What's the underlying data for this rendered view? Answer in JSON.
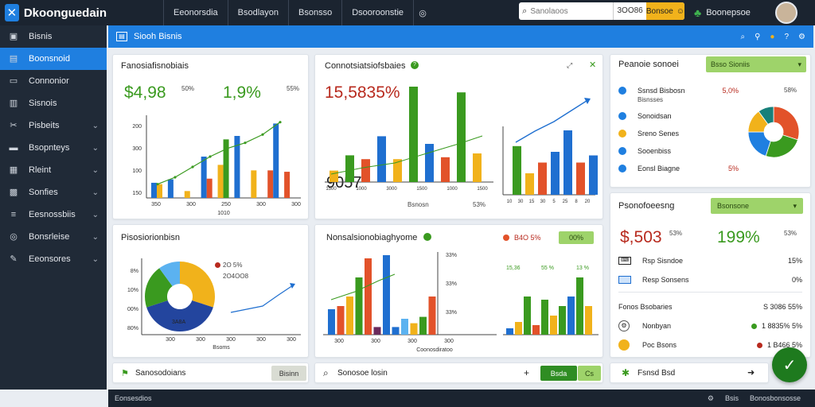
{
  "app": {
    "title": "Dkoonguedain"
  },
  "top_tabs": [
    "Eeonorsdia",
    "Bsodlayon",
    "Bsonsso",
    "Dsooroonstie"
  ],
  "search": {
    "placeholder": "Sanolaoos",
    "value": "3OO86",
    "button": "Bonsoe"
  },
  "user": {
    "name": "Boonepsoe"
  },
  "sidebar": {
    "items": [
      {
        "label": "Bisnis",
        "icon": "dashboard-icon",
        "active": false,
        "chevron": false
      },
      {
        "label": "Boonsnoid",
        "icon": "chart-icon",
        "active": true,
        "chevron": false
      },
      {
        "label": "Connonior",
        "icon": "folder-icon",
        "active": false,
        "chevron": false
      },
      {
        "label": "Sisnois",
        "icon": "grid-icon",
        "active": false,
        "chevron": false
      },
      {
        "label": "Pisbeits",
        "icon": "tools-icon",
        "active": false,
        "chevron": true
      },
      {
        "label": "Bsopnteys",
        "icon": "briefcase-icon",
        "active": false,
        "chevron": true
      },
      {
        "label": "Rleint",
        "icon": "calendar-icon",
        "active": false,
        "chevron": true
      },
      {
        "label": "Sonfies",
        "icon": "cart-icon",
        "active": false,
        "chevron": true
      },
      {
        "label": "Eesnossbiis",
        "icon": "list-icon",
        "active": false,
        "chevron": true
      },
      {
        "label": "Bonsrleise",
        "icon": "settings-icon",
        "active": false,
        "chevron": true
      },
      {
        "label": "Eeonsores",
        "icon": "pen-icon",
        "active": false,
        "chevron": true
      }
    ]
  },
  "header": {
    "title": "Siooh Bisnis"
  },
  "card1": {
    "title": "Fanosiafisnobiais",
    "value_a": "$4,98",
    "tag_a": "50%",
    "value_b": "1,9%",
    "tag_b": "55%",
    "y_ticks": [
      "200",
      "300",
      "100",
      "150"
    ],
    "x_ticks": [
      "350",
      "300",
      "250",
      "300",
      "300"
    ],
    "x_sub": "1010"
  },
  "card2": {
    "title": "Connotsiatsiofsbaies",
    "value_a": "15,5835%",
    "value_b": "9057",
    "foot_a": "Bsnosn",
    "foot_b": "53%",
    "left_ticks": [
      "1500",
      "1000",
      "3000",
      "1500",
      "1000",
      "1500"
    ],
    "right_ticks": [
      "10",
      "30",
      "15",
      "30",
      "5",
      "25",
      "8",
      "20"
    ]
  },
  "card3": {
    "title": "Pisosiorionbisn",
    "legend_value": "2O 5%",
    "legend_sub": "2O4OO8",
    "pie_label": "3A8A",
    "y_ticks": [
      "8%",
      "10%",
      "00%",
      "80%"
    ],
    "x_ticks": [
      "300",
      "300",
      "300",
      "300",
      "300"
    ],
    "x_sub": "Bsoms"
  },
  "card4": {
    "title": "Nonsalsionobiaghyome",
    "status_value": "B4O 5%",
    "pill": "00%",
    "col_ticks": [
      "33%",
      "33%",
      "33%"
    ],
    "right_labels": [
      "15,36",
      "55 %",
      "13 %"
    ],
    "x_ticks": [
      "300",
      "300",
      "300",
      "300"
    ],
    "x_sub": "Coonosdiratoo"
  },
  "right1": {
    "title": "Peanoie sonoei",
    "button": "Bsso Sioniis",
    "rows": [
      {
        "label": "Ssnsd Bisbosn",
        "value": "5,0%",
        "color": "#1f7fe0"
      },
      {
        "label": "Sonoidsan",
        "value": "",
        "color": "#1f7fe0"
      },
      {
        "label": "Sreno Senes",
        "value": "",
        "color": "#f1b21b"
      },
      {
        "label": "Sooenbiss",
        "value": "",
        "color": "#1f7fe0"
      },
      {
        "label": "Eonsl Biagne",
        "value": "5%",
        "color": "#1f7fe0"
      }
    ],
    "row_tag": "58%",
    "sub_row": "Bisnsses"
  },
  "right2": {
    "title": "Psonofoeesng",
    "button": "Bsonsone",
    "value_a": "$,503",
    "tag_a": "53%",
    "value_b": "199%",
    "tag_b": "53%",
    "rows": [
      {
        "label": "Rsp Sisndoe",
        "value": "15%"
      },
      {
        "label": "Resp Sonsens",
        "value": "0%"
      }
    ],
    "section": "Fonos Bsobaries",
    "section_value": "S 3086 55%",
    "items": [
      {
        "label": "Nonbyan",
        "value": "1 8835% 5%",
        "color": "#3a9a1f"
      },
      {
        "label": "Poc Bsons",
        "value": "1 B466 5%",
        "color": "#b82a1e"
      }
    ]
  },
  "bottom_bar": {
    "left_label": "Sanosodoians",
    "left_button": "Bisinn",
    "search_label": "Sonosoe losin",
    "plus": "+",
    "green_button": "Bsda",
    "second_button": "Cs",
    "right_label": "Fsnsd Bsd"
  },
  "footer": {
    "left": "Eonsesdios",
    "right_a": "Bsis",
    "right_b": "Bonosbonsosse"
  },
  "chart_data": [
    {
      "type": "bar",
      "title": "Fanosiafisnobiais",
      "categories": [
        "1",
        "2",
        "3",
        "4",
        "5",
        "6",
        "7",
        "8",
        "9"
      ],
      "series": [
        {
          "values": [
            22,
            27,
            0,
            60,
            0,
            0,
            0,
            0,
            0
          ],
          "color": "#1f6fd0"
        },
        {
          "values": [
            20,
            0,
            10,
            0,
            48,
            0,
            40,
            0,
            0
          ],
          "color": "#f1b21b"
        },
        {
          "values": [
            0,
            0,
            0,
            28,
            0,
            0,
            0,
            40,
            38
          ],
          "color": "#e2522a"
        },
        {
          "values": [
            0,
            0,
            0,
            0,
            85,
            0,
            0,
            0,
            0
          ],
          "color": "#3a9a1f"
        },
        {
          "values": [
            0,
            0,
            0,
            0,
            0,
            90,
            0,
            108,
            0
          ],
          "color": "#1f6fd0"
        }
      ],
      "trend": [
        20,
        30,
        45,
        60,
        72,
        80,
        92,
        110
      ]
    },
    {
      "type": "bar",
      "title": "Connotsiatsiofsbaies",
      "values": [
        12,
        28,
        24,
        48,
        24,
        100,
        40,
        26,
        94,
        30,
        68,
        30,
        45,
        60,
        90,
        45,
        55
      ],
      "colors": [
        "#f1b21b",
        "#3a9a1f",
        "#e2522a",
        "#1f6fd0",
        "#f1b21b",
        "#3a9a1f",
        "#1f6fd0",
        "#e2522a",
        "#3a9a1f",
        "#f1b21b",
        "#3a9a1f",
        "#f1b21b",
        "#e2522a",
        "#1f6fd0",
        "#1f6fd0",
        "#e2522a",
        "#1f6fd0"
      ]
    },
    {
      "type": "pie",
      "title": "Pisosiorionbisn",
      "values": [
        30,
        40,
        20,
        10
      ],
      "colors": [
        "#f1b21b",
        "#23459e",
        "#3a9a1f",
        "#5bb2f0"
      ]
    },
    {
      "type": "bar",
      "title": "Nonsalsionobiaghyome",
      "values": [
        40,
        45,
        60,
        90,
        120,
        12,
        125,
        12,
        25,
        18,
        28,
        60,
        10,
        20,
        60,
        15,
        55,
        30,
        45,
        60,
        90,
        45
      ],
      "colors": [
        "#1f6fd0",
        "#e2522a",
        "#f1b21b",
        "#3a9a1f",
        "#e2522a",
        "#6a2a5c",
        "#1f6fd0",
        "#1f6fd0",
        "#5bb2f0",
        "#f1b21b",
        "#3a9a1f",
        "#e2522a",
        "#1f6fd0",
        "#f1b21b",
        "#3a9a1f",
        "#e2522a",
        "#3a9a1f",
        "#f1b21b",
        "#3a9a1f",
        "#1f6fd0",
        "#3a9a1f",
        "#f1b21b"
      ]
    },
    {
      "type": "pie",
      "title": "Peanoie sonoei",
      "values": [
        30,
        25,
        20,
        15,
        10
      ],
      "colors": [
        "#e2522a",
        "#3a9a1f",
        "#1f7fe0",
        "#f1b21b",
        "#17807a"
      ]
    }
  ]
}
